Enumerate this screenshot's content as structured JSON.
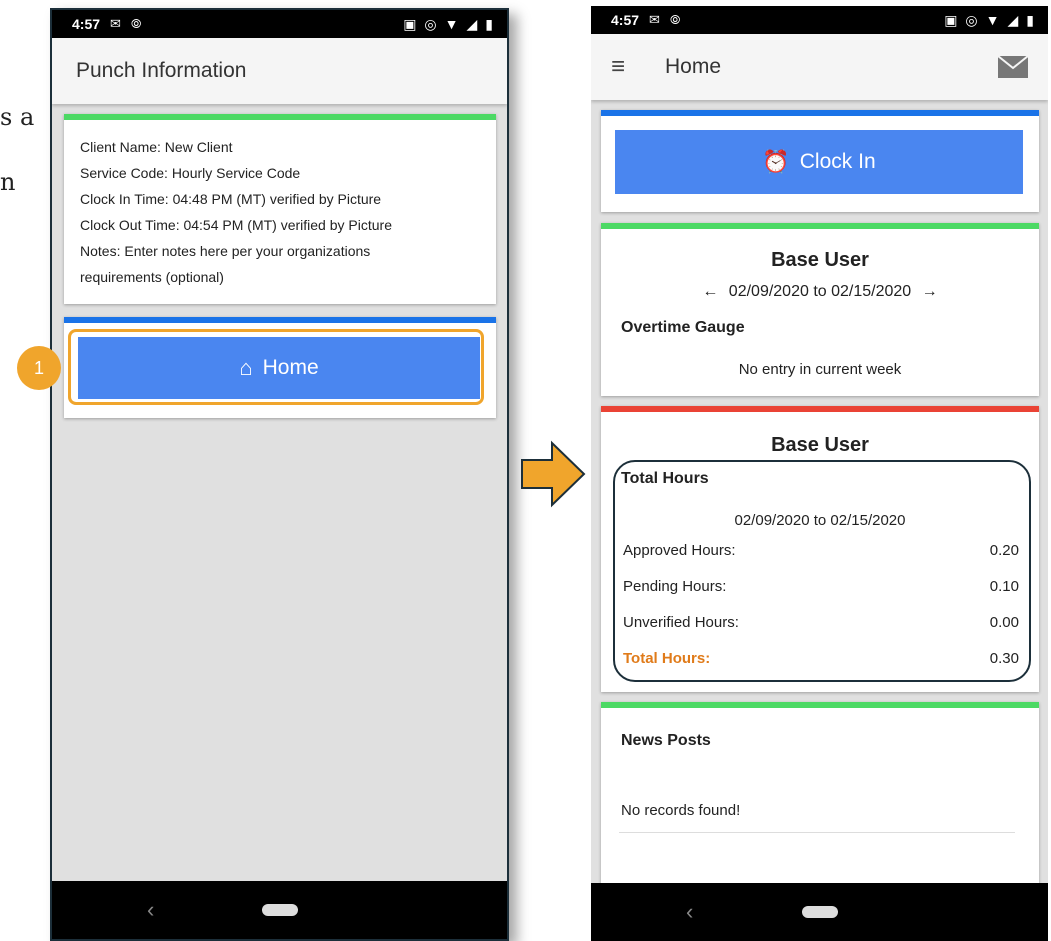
{
  "background_text": {
    "line1": "s a",
    "line2": "n"
  },
  "left_phone": {
    "status": {
      "time": "4:57"
    },
    "title": "Punch Information",
    "punch": {
      "client": "Client Name: New Client",
      "service": "Service Code: Hourly Service Code",
      "clock_in": "Clock In Time: 04:48 PM (MT) verified by Picture",
      "clock_out": "Clock Out Time: 04:54 PM (MT) verified by Picture",
      "notes_line1": "Notes: Enter notes here per your organizations",
      "notes_line2": "requirements (optional)"
    },
    "home_button": "Home",
    "step_badge": "1"
  },
  "right_phone": {
    "status": {
      "time": "4:57"
    },
    "title": "Home",
    "clock_in_button": "Clock In",
    "overtime_card": {
      "user": "Base User",
      "date_range": "02/09/2020 to 02/15/2020",
      "section": "Overtime Gauge",
      "empty": "No entry in current week"
    },
    "hours_card": {
      "user": "Base User",
      "section": "Total Hours",
      "date_range": "02/09/2020 to 02/15/2020",
      "rows": [
        {
          "label": "Approved Hours:",
          "value": "0.20"
        },
        {
          "label": "Pending Hours:",
          "value": "0.10"
        },
        {
          "label": "Unverified Hours:",
          "value": "0.00"
        },
        {
          "label": "Total Hours:",
          "value": "0.30"
        }
      ]
    },
    "news_card": {
      "title": "News Posts",
      "empty": "No records found!"
    }
  },
  "colors": {
    "green": "#4cd964",
    "blue": "#1a73e8",
    "red": "#ea4335",
    "button": "#4a86f0",
    "accent": "#f0a52c",
    "total_label": "#e07b1a"
  }
}
